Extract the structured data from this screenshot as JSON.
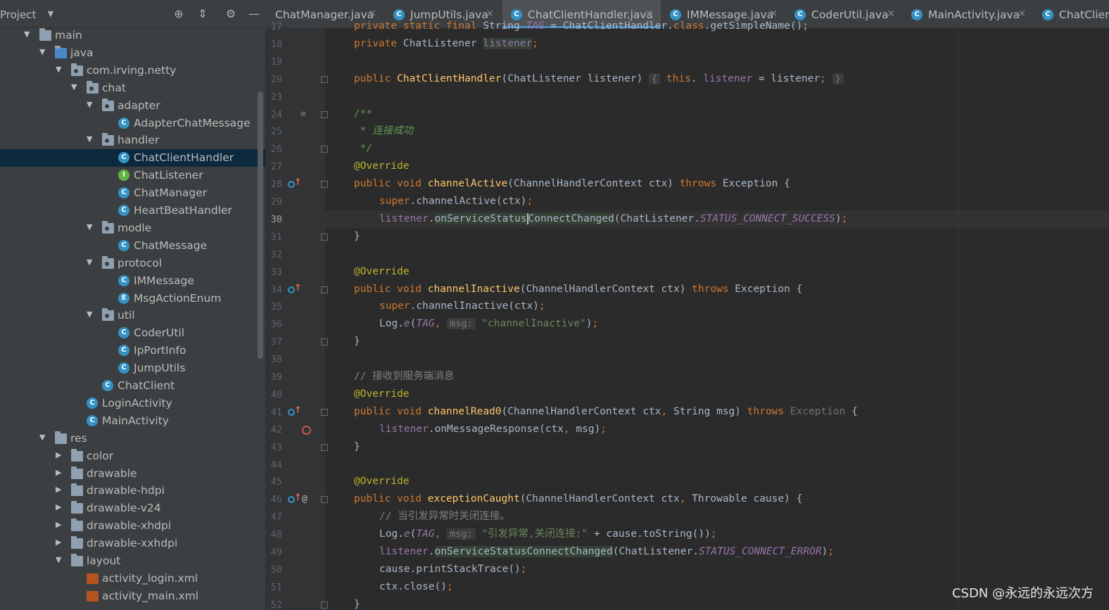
{
  "project": {
    "title": "Project",
    "tree": [
      {
        "label": "main",
        "kind": "folder",
        "depth": 1,
        "expanded": true
      },
      {
        "label": "java",
        "kind": "folder-blue",
        "depth": 2,
        "expanded": true
      },
      {
        "label": "com.irving.netty",
        "kind": "package",
        "depth": 3,
        "expanded": true
      },
      {
        "label": "chat",
        "kind": "package",
        "depth": 4,
        "expanded": true
      },
      {
        "label": "adapter",
        "kind": "package",
        "depth": 5,
        "expanded": true
      },
      {
        "label": "AdapterChatMessage",
        "kind": "class",
        "depth": 6
      },
      {
        "label": "handler",
        "kind": "package",
        "depth": 5,
        "expanded": true
      },
      {
        "label": "ChatClientHandler",
        "kind": "class",
        "depth": 6,
        "selected": true
      },
      {
        "label": "ChatListener",
        "kind": "interface",
        "depth": 6
      },
      {
        "label": "ChatManager",
        "kind": "class",
        "depth": 6
      },
      {
        "label": "HeartBeatHandler",
        "kind": "class",
        "depth": 6
      },
      {
        "label": "modle",
        "kind": "package",
        "depth": 5,
        "expanded": true
      },
      {
        "label": "ChatMessage",
        "kind": "class",
        "depth": 6
      },
      {
        "label": "protocol",
        "kind": "package",
        "depth": 5,
        "expanded": true
      },
      {
        "label": "IMMessage",
        "kind": "class",
        "depth": 6
      },
      {
        "label": "MsgActionEnum",
        "kind": "enum",
        "depth": 6
      },
      {
        "label": "util",
        "kind": "package",
        "depth": 5,
        "expanded": true
      },
      {
        "label": "CoderUtil",
        "kind": "class",
        "depth": 6
      },
      {
        "label": "IpPortInfo",
        "kind": "class",
        "depth": 6
      },
      {
        "label": "JumpUtils",
        "kind": "class",
        "depth": 6
      },
      {
        "label": "ChatClient",
        "kind": "class",
        "depth": 5
      },
      {
        "label": "LoginActivity",
        "kind": "class",
        "depth": 4
      },
      {
        "label": "MainActivity",
        "kind": "class",
        "depth": 4
      },
      {
        "label": "res",
        "kind": "res",
        "depth": 2,
        "expanded": true
      },
      {
        "label": "color",
        "kind": "folder",
        "depth": 3,
        "expanded": false
      },
      {
        "label": "drawable",
        "kind": "folder",
        "depth": 3,
        "expanded": false
      },
      {
        "label": "drawable-hdpi",
        "kind": "folder",
        "depth": 3,
        "expanded": false
      },
      {
        "label": "drawable-v24",
        "kind": "folder",
        "depth": 3,
        "expanded": false
      },
      {
        "label": "drawable-xhdpi",
        "kind": "folder",
        "depth": 3,
        "expanded": false
      },
      {
        "label": "drawable-xxhdpi",
        "kind": "folder",
        "depth": 3,
        "expanded": false
      },
      {
        "label": "layout",
        "kind": "folder",
        "depth": 3,
        "expanded": true
      },
      {
        "label": "activity_login.xml",
        "kind": "xml",
        "depth": 4
      },
      {
        "label": "activity_main.xml",
        "kind": "xml",
        "depth": 4
      }
    ]
  },
  "tabs": [
    {
      "label": "ChatManager.java",
      "active": false,
      "partial_left": true
    },
    {
      "label": "JumpUtils.java",
      "active": false
    },
    {
      "label": "ChatClientHandler.java",
      "active": true
    },
    {
      "label": "IMMessage.java",
      "active": false
    },
    {
      "label": "CoderUtil.java",
      "active": false
    },
    {
      "label": "MainActivity.java",
      "active": false
    },
    {
      "label": "ChatClien",
      "active": false,
      "partial_right": true
    }
  ],
  "editor": {
    "current_line": "30",
    "lines": [
      {
        "n": "17",
        "segs": [
          [
            "kw",
            "private static final "
          ],
          [
            "",
            "String "
          ],
          [
            "st",
            "TAG"
          ],
          [
            "",
            " = ChatClientHandler."
          ],
          [
            "kw",
            "class"
          ],
          [
            "",
            ".getSimpleName();"
          ]
        ],
        "indent": 0
      },
      {
        "n": "18",
        "segs": [
          [
            "kw",
            "private "
          ],
          [
            "",
            "ChatListener "
          ],
          [
            "fld hl",
            "listener"
          ],
          [
            "kw",
            ";"
          ]
        ],
        "indent": 0
      },
      {
        "n": "19",
        "segs": [],
        "indent": 0
      },
      {
        "n": "20",
        "segs": [
          [
            "kw",
            "public "
          ],
          [
            "fn",
            "ChatClientHandler"
          ],
          [
            "",
            "(ChatListener listener) "
          ],
          [
            "hint",
            "{"
          ],
          [
            "",
            " "
          ],
          [
            "kw",
            "this"
          ],
          [
            "",
            ". "
          ],
          [
            "fld",
            "listener"
          ],
          [
            "",
            " = listener"
          ],
          [
            "kw",
            ";"
          ],
          [
            "",
            " "
          ],
          [
            "hint",
            "}"
          ]
        ],
        "indent": 0
      },
      {
        "n": "23",
        "segs": [],
        "indent": 0
      },
      {
        "n": "24",
        "segs": [
          [
            "doc",
            "/**"
          ]
        ],
        "indent": 0
      },
      {
        "n": "25",
        "segs": [
          [
            "doc",
            " * 连接成功"
          ]
        ],
        "indent": 0
      },
      {
        "n": "26",
        "segs": [
          [
            "doc",
            " */"
          ]
        ],
        "indent": 0
      },
      {
        "n": "27",
        "segs": [
          [
            "ann",
            "@Override"
          ]
        ],
        "indent": 0
      },
      {
        "n": "28",
        "segs": [
          [
            "kw",
            "public void "
          ],
          [
            "fn",
            "channelActive"
          ],
          [
            "",
            "(ChannelHandlerContext ctx) "
          ],
          [
            "kw",
            "throws "
          ],
          [
            "",
            "Exception {"
          ]
        ],
        "indent": 0
      },
      {
        "n": "29",
        "segs": [
          [
            "kw",
            "super"
          ],
          [
            "",
            ".channelActive(ctx)"
          ],
          [
            "kw",
            ";"
          ]
        ],
        "indent": 1
      },
      {
        "n": "30",
        "segs": [
          [
            "fld",
            "listener"
          ],
          [
            "",
            "."
          ],
          [
            "hl",
            "onServiceStatus"
          ],
          [
            "caret",
            ""
          ],
          [
            "hl",
            "ConnectChanged"
          ],
          [
            "",
            "(ChatListener."
          ],
          [
            "st",
            "STATUS_CONNECT_SUCCESS"
          ],
          [
            "",
            ")"
          ],
          [
            "kw",
            ";"
          ]
        ],
        "indent": 1
      },
      {
        "n": "31",
        "segs": [
          [
            "",
            "}"
          ]
        ],
        "indent": 0
      },
      {
        "n": "32",
        "segs": [],
        "indent": 0
      },
      {
        "n": "33",
        "segs": [
          [
            "ann",
            "@Override"
          ]
        ],
        "indent": 0
      },
      {
        "n": "34",
        "segs": [
          [
            "kw",
            "public void "
          ],
          [
            "fn",
            "channelInactive"
          ],
          [
            "",
            "(ChannelHandlerContext ctx) "
          ],
          [
            "kw",
            "throws "
          ],
          [
            "",
            "Exception {"
          ]
        ],
        "indent": 0
      },
      {
        "n": "35",
        "segs": [
          [
            "kw",
            "super"
          ],
          [
            "",
            ".channelInactive(ctx)"
          ],
          [
            "kw",
            ";"
          ]
        ],
        "indent": 1
      },
      {
        "n": "36",
        "segs": [
          [
            "",
            "Log."
          ],
          [
            "st",
            "e"
          ],
          [
            "",
            "("
          ],
          [
            "st",
            "TAG"
          ],
          [
            "kw",
            ", "
          ],
          [
            "hint",
            "msg:"
          ],
          [
            "",
            " "
          ],
          [
            "str",
            "\"channelInactive\""
          ],
          [
            "",
            ")"
          ],
          [
            "kw",
            ";"
          ]
        ],
        "indent": 1
      },
      {
        "n": "37",
        "segs": [
          [
            "",
            "}"
          ]
        ],
        "indent": 0
      },
      {
        "n": "38",
        "segs": [],
        "indent": 0
      },
      {
        "n": "39",
        "segs": [
          [
            "cm",
            "// 接收到服务端消息"
          ]
        ],
        "indent": 0
      },
      {
        "n": "40",
        "segs": [
          [
            "ann",
            "@Override"
          ]
        ],
        "indent": 0
      },
      {
        "n": "41",
        "segs": [
          [
            "kw",
            "public void "
          ],
          [
            "fn",
            "channelRead0"
          ],
          [
            "",
            "(ChannelHandlerContext ctx"
          ],
          [
            "kw",
            ", "
          ],
          [
            "",
            "String msg) "
          ],
          [
            "kw",
            "throws "
          ],
          [
            "unused",
            "Exception"
          ],
          [
            "",
            " {"
          ]
        ],
        "indent": 0
      },
      {
        "n": "42",
        "segs": [
          [
            "fld",
            "listener"
          ],
          [
            "",
            ".onMessageResponse(ctx"
          ],
          [
            "kw",
            ", "
          ],
          [
            "",
            "msg)"
          ],
          [
            "kw",
            ";"
          ]
        ],
        "indent": 1
      },
      {
        "n": "43",
        "segs": [
          [
            "",
            "}"
          ]
        ],
        "indent": 0
      },
      {
        "n": "44",
        "segs": [],
        "indent": 0
      },
      {
        "n": "45",
        "segs": [
          [
            "ann",
            "@Override"
          ]
        ],
        "indent": 0
      },
      {
        "n": "46",
        "segs": [
          [
            "kw",
            "public void "
          ],
          [
            "fn",
            "exceptionCaught"
          ],
          [
            "",
            "(ChannelHandlerContext ctx"
          ],
          [
            "kw",
            ", "
          ],
          [
            "",
            "Throwable cause) {"
          ]
        ],
        "indent": 0
      },
      {
        "n": "47",
        "segs": [
          [
            "cm",
            "// 当引发异常时关闭连接。"
          ]
        ],
        "indent": 1
      },
      {
        "n": "48",
        "segs": [
          [
            "",
            "Log."
          ],
          [
            "st",
            "e"
          ],
          [
            "",
            "("
          ],
          [
            "st",
            "TAG"
          ],
          [
            "kw",
            ", "
          ],
          [
            "hint",
            "msg:"
          ],
          [
            "",
            " "
          ],
          [
            "str",
            "\"引发异常,关闭连接:\""
          ],
          [
            "",
            " + cause.toString())"
          ],
          [
            "kw",
            ";"
          ]
        ],
        "indent": 1
      },
      {
        "n": "49",
        "segs": [
          [
            "fld",
            "listener"
          ],
          [
            "",
            "."
          ],
          [
            "hl",
            "onServiceStatusConnectChanged"
          ],
          [
            "",
            "(ChatListener."
          ],
          [
            "st",
            "STATUS_CONNECT_ERROR"
          ],
          [
            "",
            ")"
          ],
          [
            "kw",
            ";"
          ]
        ],
        "indent": 1
      },
      {
        "n": "50",
        "segs": [
          [
            "",
            "cause.printStackTrace()"
          ],
          [
            "kw",
            ";"
          ]
        ],
        "indent": 1
      },
      {
        "n": "51",
        "segs": [
          [
            "",
            "ctx.close()"
          ],
          [
            "kw",
            ";"
          ]
        ],
        "indent": 1
      },
      {
        "n": "52",
        "segs": [
          [
            "",
            "}"
          ]
        ],
        "indent": 0
      }
    ]
  },
  "watermark": "CSDN @永远的永远次方"
}
